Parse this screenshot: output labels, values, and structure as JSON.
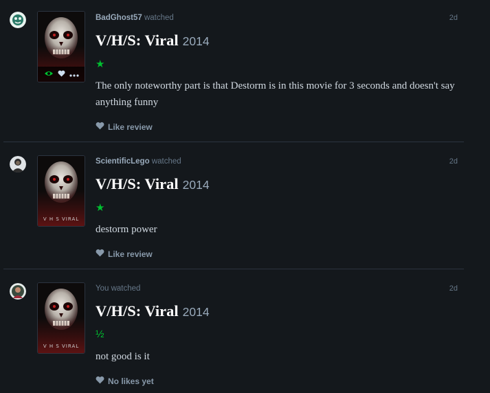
{
  "reviews": [
    {
      "user": "BadGhost57",
      "verb": "watched",
      "date": "2d",
      "film_title": "V/H/S: Viral",
      "year": "2014",
      "rating": "★",
      "text": "The only noteworthy part is that Destorm is in this movie for 3 seconds and doesn't say anything funny",
      "like_label": "Like review",
      "poster_overlay": true
    },
    {
      "user": "ScientificLego",
      "verb": "watched",
      "date": "2d",
      "film_title": "V/H/S: Viral",
      "year": "2014",
      "rating": "★",
      "text": "destorm power",
      "like_label": "Like review",
      "poster_caption": "V H S  VIRAL"
    },
    {
      "user": "",
      "verb": "You watched",
      "date": "2d",
      "film_title": "V/H/S: Viral",
      "year": "2014",
      "rating": "½",
      "text": "not good is it",
      "like_label": "No likes yet",
      "poster_caption": "V H S  VIRAL"
    }
  ],
  "colors": {
    "background": "#14181c",
    "accent_green": "#00c030",
    "title": "#ffffff",
    "muted": "#678"
  },
  "icons": [
    "eye-icon",
    "heart-icon",
    "more-icon",
    "star-icon"
  ]
}
